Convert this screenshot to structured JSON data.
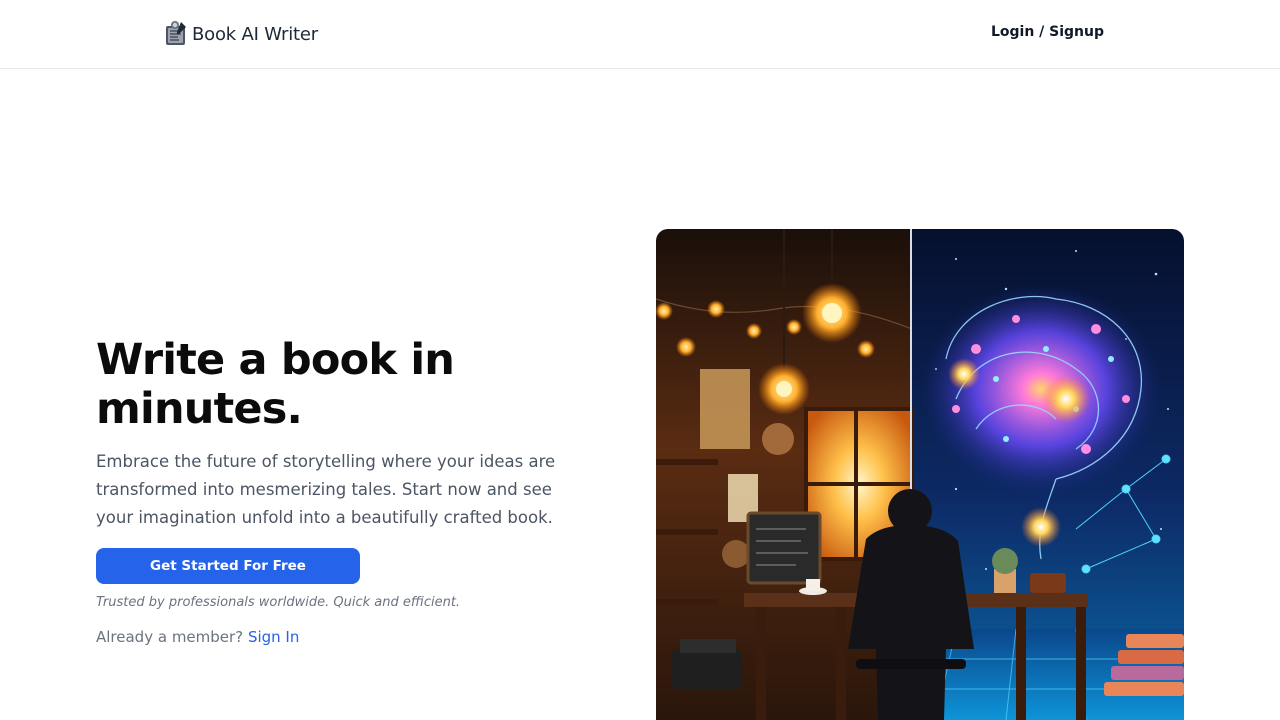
{
  "nav": {
    "brand_name": "Book AI Writer",
    "brand_icon": "book-writer-logo-icon",
    "login_label": "Login / Signup"
  },
  "hero": {
    "title": "Write a book in minutes.",
    "subtitle": "Embrace the future of storytelling where your ideas are transformed into mesmerizing tales. Start now and see your imagination unfold into a beautifully crafted book.",
    "cta_label": "Get Started For Free",
    "trusted_text": "Trusted by professionals worldwide. Quick and efficient.",
    "member_prompt": "Already a member?",
    "signin_label": "Sign In"
  },
  "illustration": {
    "subject": "writer-at-desk-with-glowing-ai-brain-illustration"
  },
  "colors": {
    "accent": "#2563eb",
    "heading": "#0b0b0b",
    "body_text": "#4b5563",
    "muted_text": "#6b7280",
    "divider": "#e5e7eb"
  }
}
